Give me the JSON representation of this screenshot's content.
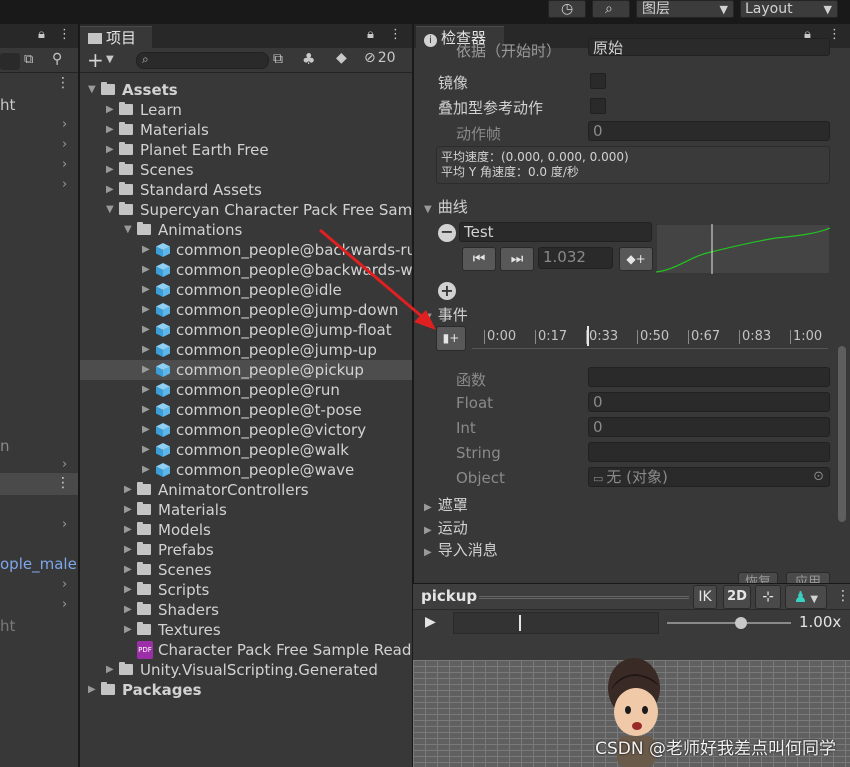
{
  "toolbar": {
    "layers_label": "图层",
    "layout_label": "Layout"
  },
  "hierarchy": {
    "items": [
      "ht",
      "n",
      "ople_male",
      "ht"
    ]
  },
  "project": {
    "tab_label": "项目",
    "search_placeholder": "",
    "hidden_count": "20",
    "tree": [
      {
        "label": "Assets",
        "depth": 0,
        "type": "folder-open",
        "bold": true
      },
      {
        "label": "Learn",
        "depth": 1,
        "type": "folder"
      },
      {
        "label": "Materials",
        "depth": 1,
        "type": "folder"
      },
      {
        "label": "Planet Earth Free",
        "depth": 1,
        "type": "folder"
      },
      {
        "label": "Scenes",
        "depth": 1,
        "type": "folder"
      },
      {
        "label": "Standard Assets",
        "depth": 1,
        "type": "folder"
      },
      {
        "label": "Supercyan Character Pack Free Sample",
        "depth": 1,
        "type": "folder-open"
      },
      {
        "label": "Animations",
        "depth": 2,
        "type": "folder-open"
      },
      {
        "label": "common_people@backwards-run",
        "depth": 3,
        "type": "fbx"
      },
      {
        "label": "common_people@backwards-walk",
        "depth": 3,
        "type": "fbx"
      },
      {
        "label": "common_people@idle",
        "depth": 3,
        "type": "fbx"
      },
      {
        "label": "common_people@jump-down",
        "depth": 3,
        "type": "fbx"
      },
      {
        "label": "common_people@jump-float",
        "depth": 3,
        "type": "fbx"
      },
      {
        "label": "common_people@jump-up",
        "depth": 3,
        "type": "fbx"
      },
      {
        "label": "common_people@pickup",
        "depth": 3,
        "type": "fbx",
        "selected": true
      },
      {
        "label": "common_people@run",
        "depth": 3,
        "type": "fbx"
      },
      {
        "label": "common_people@t-pose",
        "depth": 3,
        "type": "fbx"
      },
      {
        "label": "common_people@victory",
        "depth": 3,
        "type": "fbx"
      },
      {
        "label": "common_people@walk",
        "depth": 3,
        "type": "fbx"
      },
      {
        "label": "common_people@wave",
        "depth": 3,
        "type": "fbx"
      },
      {
        "label": "AnimatorControllers",
        "depth": 2,
        "type": "folder"
      },
      {
        "label": "Materials",
        "depth": 2,
        "type": "folder"
      },
      {
        "label": "Models",
        "depth": 2,
        "type": "folder"
      },
      {
        "label": "Prefabs",
        "depth": 2,
        "type": "folder"
      },
      {
        "label": "Scenes",
        "depth": 2,
        "type": "folder"
      },
      {
        "label": "Scripts",
        "depth": 2,
        "type": "folder"
      },
      {
        "label": "Shaders",
        "depth": 2,
        "type": "folder"
      },
      {
        "label": "Textures",
        "depth": 2,
        "type": "folder"
      },
      {
        "label": "Character Pack Free Sample Readme",
        "depth": 2,
        "type": "pdf"
      },
      {
        "label": "Unity.VisualScripting.Generated",
        "depth": 1,
        "type": "folder"
      },
      {
        "label": "Packages",
        "depth": 0,
        "type": "folder",
        "bold": true
      }
    ]
  },
  "inspector": {
    "tab_label": "检查器",
    "top_cut_label": "依据（开始时）",
    "top_cut_value": "原始",
    "mirror_label": "镜像",
    "additive_label": "叠加型参考动作",
    "frame_label": "动作帧",
    "frame_value": "0",
    "avg_speed": "平均速度：(0.000, 0.000, 0.000)",
    "avg_y_speed": "平均 Y 角速度：0.0 度/秒",
    "curves_label": "曲线",
    "curve_name": "Test",
    "curve_value": "1.032",
    "events_label": "事件",
    "timeline_ticks": [
      "0:00",
      "0:17",
      "0:33",
      "0:50",
      "0:67",
      "0:83",
      "1:00"
    ],
    "function_label": "函数",
    "float_label": "Float",
    "float_value": "0",
    "int_label": "Int",
    "int_value": "0",
    "string_label": "String",
    "object_label": "Object",
    "object_value": "无 (对象)",
    "mask_label": "遮罩",
    "motion_label": "运动",
    "import_msg_label": "导入消息",
    "revert_label": "恢复",
    "apply_label": "应用"
  },
  "preview": {
    "clip_name": "pickup",
    "ik_label": "IK",
    "mode_2d_label": "2D",
    "speed_label": "1.00x",
    "speed_fraction": 0.6
  },
  "watermark": "CSDN @老师好我差点叫何同学"
}
